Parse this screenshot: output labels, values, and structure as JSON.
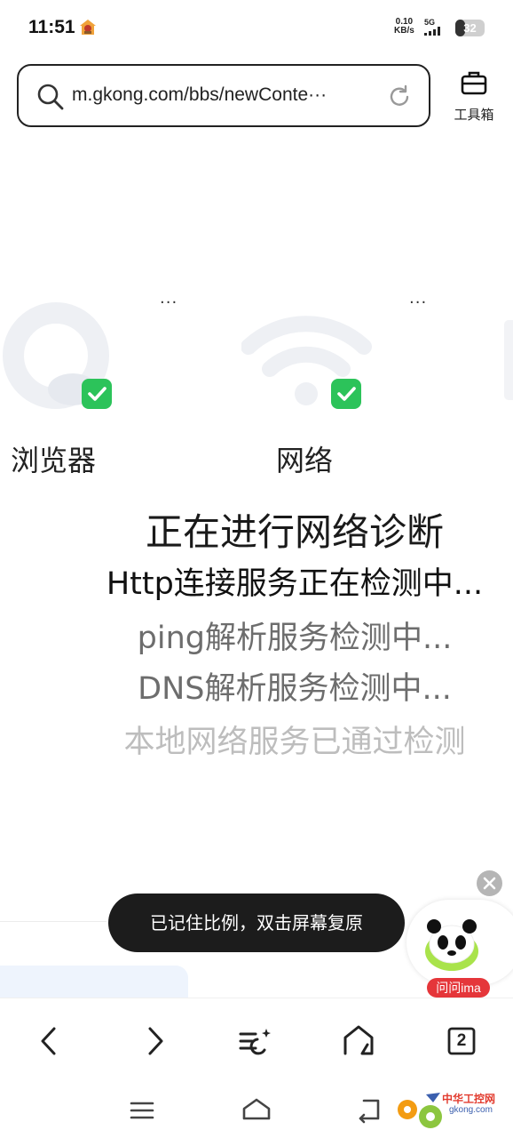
{
  "status_bar": {
    "time": "11:51",
    "net_speed_value": "0.10",
    "net_speed_unit": "KB/s",
    "net_type": "5G",
    "battery_level": "32",
    "battery_fraction": 0.32
  },
  "address_bar": {
    "url": "m.gkong.com/bbs/newConte···",
    "search_icon": "search-icon",
    "reload_icon": "reload-icon"
  },
  "toolbox": {
    "label": "工具箱",
    "icon": "toolbox-icon"
  },
  "diagnostics": {
    "items": [
      {
        "label": "浏览器",
        "dots": "···",
        "icon": "browser-logo-icon",
        "status": "checked"
      },
      {
        "label": "网络",
        "dots": "···",
        "icon": "wifi-icon",
        "status": "checked"
      }
    ],
    "title": "正在进行网络诊断",
    "lines": [
      "Http连接服务正在检测中...",
      "ping解析服务检测中...",
      "DNS解析服务检测中...",
      "本地网络服务已通过检测"
    ],
    "check_color": "#2cc35a"
  },
  "toast": {
    "text": "已记住比例，双击屏幕复原"
  },
  "ima": {
    "label": "问问ima",
    "accent": "#e5363a"
  },
  "bottom_toolbar": {
    "tab_count": "2"
  },
  "watermark": {
    "title": "中华工控网",
    "site": "gkong.com"
  }
}
